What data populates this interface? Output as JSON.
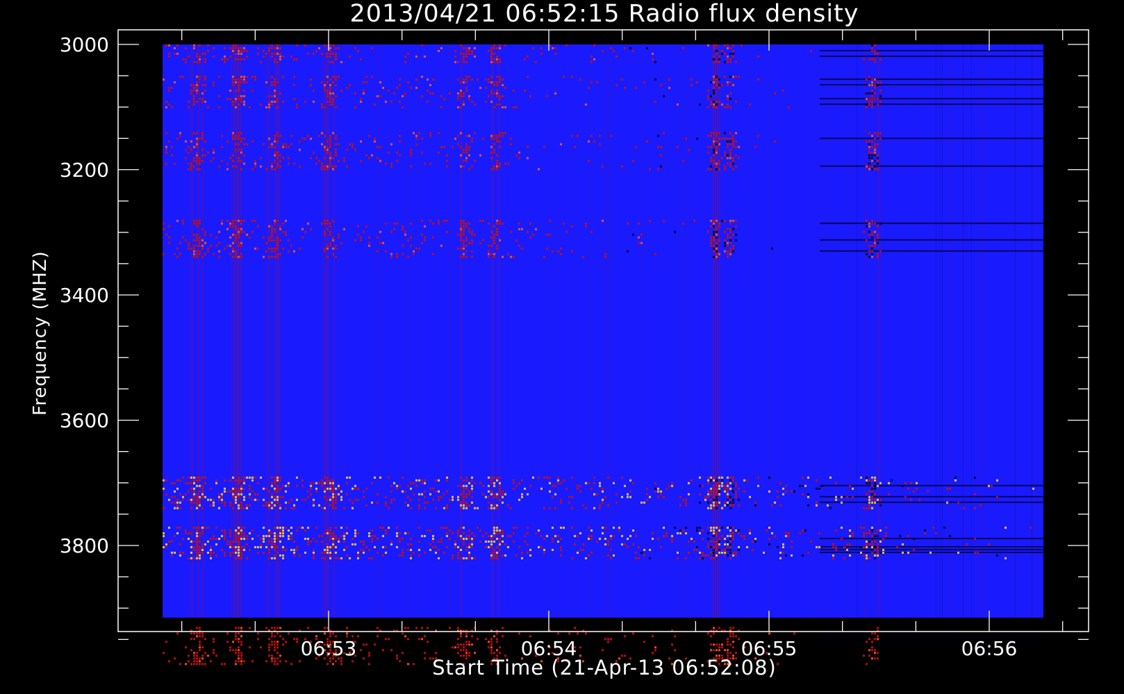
{
  "chart_data": {
    "type": "heatmap",
    "title": "2013/04/21 06:52:15 Radio flux density",
    "xlabel": "Start Time (21-Apr-13 06:52:08)",
    "ylabel": "Frequency (MHZ)",
    "y_ticks": [
      3000,
      3200,
      3400,
      3600,
      3800
    ],
    "x_ticks": [
      "06:53",
      "06:54",
      "06:55",
      "06:56"
    ],
    "ylim": [
      3000,
      4000
    ],
    "y_inverted": true,
    "xlim": [
      "06:52:08",
      "06:56:16"
    ],
    "colormap": "blue-black-red-yellow",
    "colors": {
      "background": "#000000",
      "base": "#1a1aff",
      "low": "#000000",
      "mid": "#cc1010",
      "high": "#ffd23c"
    },
    "bright_frequency_bands_mhz": [
      [
        3000,
        3030
      ],
      [
        3050,
        3100
      ],
      [
        3140,
        3200
      ],
      [
        3280,
        3340
      ],
      [
        3690,
        3740
      ],
      [
        3770,
        3820
      ],
      [
        3930,
        3990
      ]
    ],
    "bright_time_bursts": [
      "06:52:12",
      "06:52:24",
      "06:52:35",
      "06:52:45",
      "06:53:00",
      "06:53:37",
      "06:53:45",
      "06:54:45",
      "06:54:49",
      "06:55:28"
    ]
  }
}
